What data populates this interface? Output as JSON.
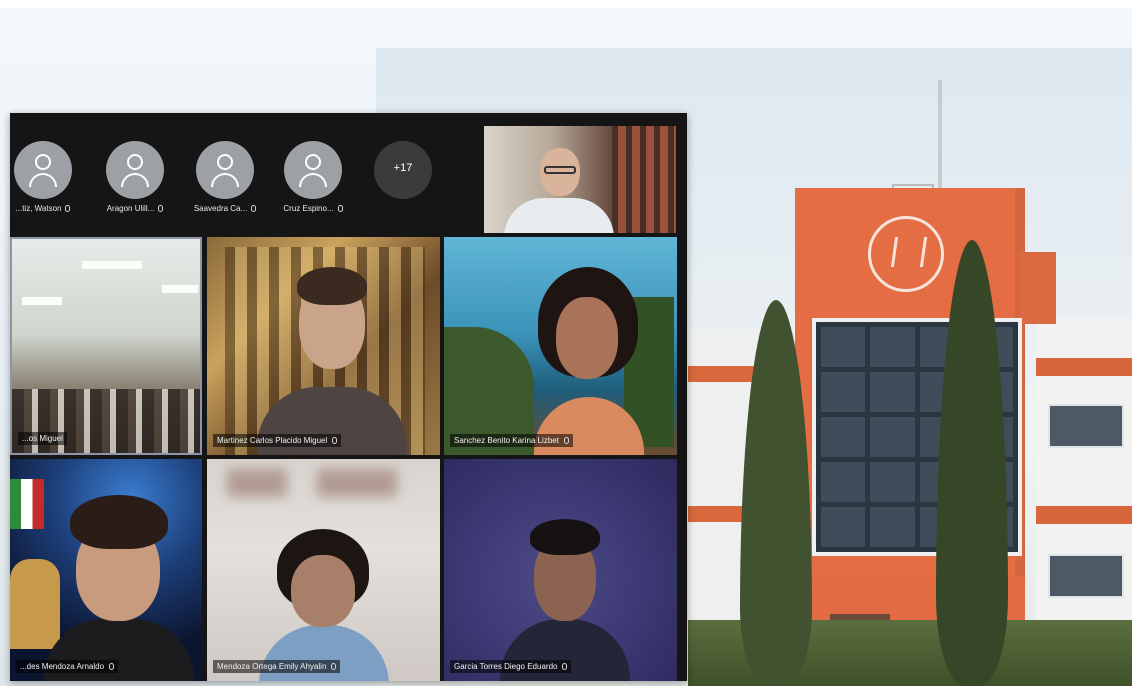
{
  "meeting": {
    "participant_strip": [
      {
        "name": "...tiz, Watson",
        "avatar_icon": "person-icon"
      },
      {
        "name": "Aragon Ulill...",
        "avatar_icon": "person-icon"
      },
      {
        "name": "Saavedra Ca...",
        "avatar_icon": "person-icon"
      },
      {
        "name": "Cruz Espino...",
        "avatar_icon": "person-icon"
      }
    ],
    "more_count": "+17",
    "host_video": {
      "label": ""
    },
    "tiles": [
      {
        "label": "...os Miguel"
      },
      {
        "label": "Martinez Carlos Placido Miguel"
      },
      {
        "label": "Sanchez Benito Karina Lizbet"
      },
      {
        "label": "...des Mendoza Arnaldo"
      },
      {
        "label": "Mendoza Ortega Emily Ahyalin"
      },
      {
        "label": "Garcia Torres Diego Eduardo"
      }
    ]
  },
  "colors": {
    "meeting_bg": "#151515",
    "building_orange": "#e46d44",
    "avatar_gray": "#9da0a4"
  }
}
